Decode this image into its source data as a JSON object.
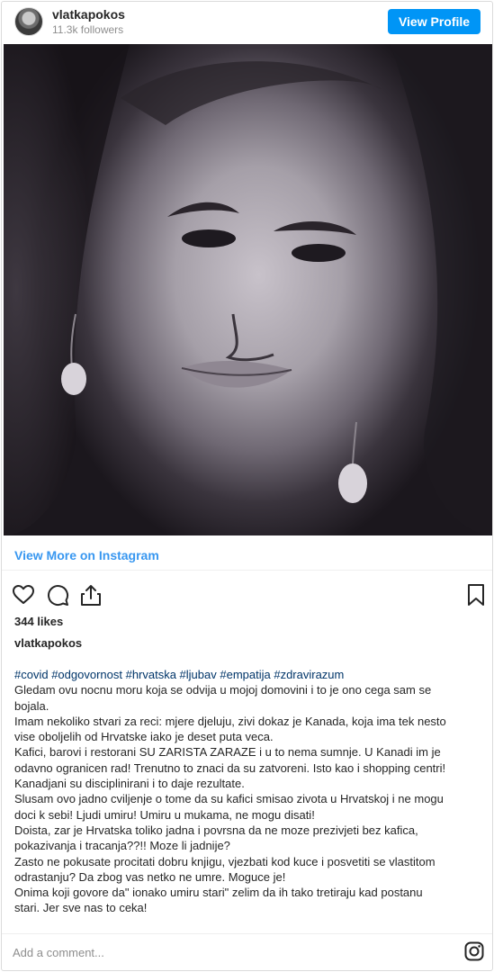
{
  "header": {
    "username": "vlatkapokos",
    "followers": "11.3k followers",
    "view_profile_label": "View Profile"
  },
  "post": {
    "image_icon": "portrait-photo",
    "view_more_label": "View More on Instagram",
    "likes": "344 likes",
    "caption_user": "vlatkapokos",
    "hashtags": "#covid #odgovornost #hrvatska #ljubav #empatija #zdravirazum",
    "caption_lines": [
      "Gledam ovu nocnu moru koja se odvija u mojoj domovini i to je ono cega sam se",
      "bojala.",
      "Imam nekoliko stvari za reci: mjere djeluju, zivi dokaz je Kanada, koja ima tek nesto",
      "vise oboljelih od Hrvatske iako je deset puta veca.",
      "Kafici, barovi i restorani SU ZARISTA ZARAZE i u to nema sumnje. U Kanadi im je",
      "odavno ogranicen rad! Trenutno to znaci da su zatvoreni. Isto kao i shopping centri!",
      "Kanadjani su disciplinirani i to daje rezultate.",
      "Slusam ovo jadno cviljenje o tome da su kafici smisao zivota u Hrvatskoj i ne mogu",
      "doci k sebi! Ljudi umiru! Umiru u mukama, ne mogu disati!",
      "Doista, zar je Hrvatska toliko jadna i povrsna da ne moze prezivjeti bez kafica,",
      "pokazivanja i tracanja??!! Moze li jadnije?",
      "Zasto ne pokusate procitati dobru knjigu, vjezbati kod kuce i posvetiti se vlastitom",
      "odrastanju? Da zbog vas netko ne umre. Moguce je!",
      "Onima koji govore da\" ionako umiru stari\" zelim da ih tako tretiraju kad postanu",
      "stari. Jer sve nas to ceka!"
    ]
  },
  "actions": {
    "icons": [
      "heart-icon",
      "comment-icon",
      "share-icon",
      "bookmark-icon"
    ]
  },
  "comment": {
    "placeholder": "Add a comment...",
    "icon": "instagram-icon"
  },
  "colors": {
    "accent": "#0095f6",
    "link": "#3897f0",
    "hashtag": "#003569",
    "muted": "#8e8e8e",
    "text": "#262626"
  }
}
